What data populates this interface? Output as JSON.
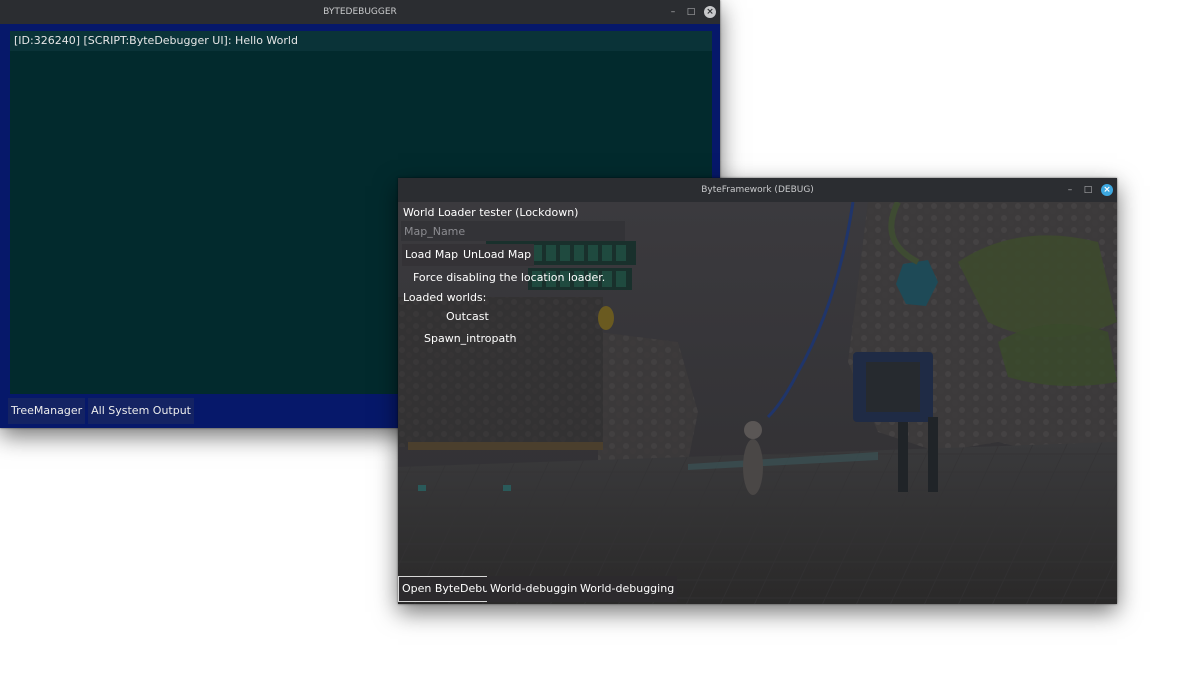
{
  "debugger_window": {
    "title": "BYTEDEBUGGER",
    "controls": {
      "minimize": "–",
      "maximize": "□",
      "close": "×"
    },
    "log_lines": [
      "[ID:326240]  [SCRIPT:ByteDebugger UI]:  Hello World"
    ],
    "tabs": [
      "TreeManager",
      "All System Output"
    ]
  },
  "framework_window": {
    "title": "ByteFramework (DEBUG)",
    "controls": {
      "minimize": "–",
      "maximize": "□",
      "close": "×"
    },
    "panel": {
      "heading": "World Loader tester (Lockdown)",
      "map_input": {
        "value": "",
        "placeholder": "Map_Name"
      },
      "load_button": "Load Map",
      "unload_button": "UnLoad Map",
      "force_disable_label": "Force disabling the location loader.",
      "loaded_worlds_label": "Loaded worlds:",
      "worlds": [
        "Outcast",
        "Spawn_intropath"
      ]
    },
    "bottom_buttons": [
      "Open ByteDebug",
      "World-debugging",
      "World-debugging"
    ],
    "active_bottom_button": "Open ByteDebug"
  },
  "colors": {
    "debugger_frame": "#06186a",
    "debugger_bg": "#022a2d",
    "titlebar": "#2b2d31",
    "close_accent": "#3da8e0"
  }
}
